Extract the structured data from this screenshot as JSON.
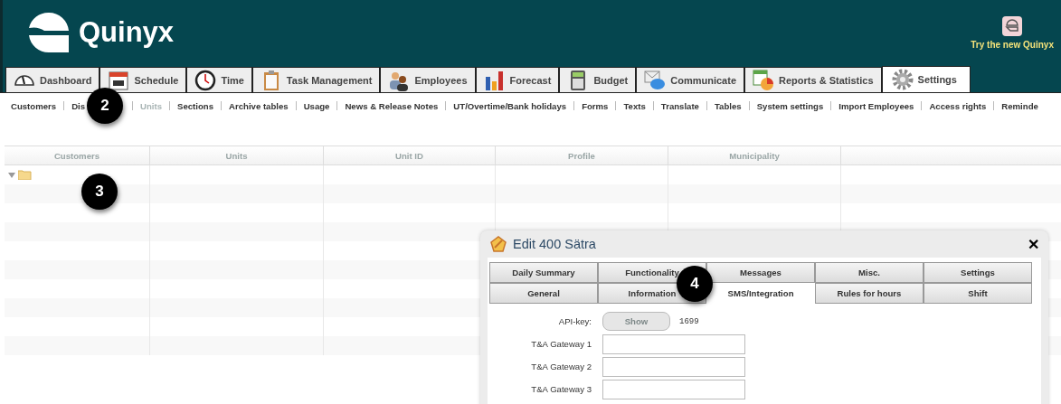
{
  "header": {
    "logo_text": "Quinyx",
    "try_new": "Try the new Quinyx"
  },
  "tabs": [
    {
      "label": "Dashboard",
      "selected": false
    },
    {
      "label": "Schedule",
      "selected": false
    },
    {
      "label": "Time",
      "selected": false
    },
    {
      "label": "Task Management",
      "selected": false
    },
    {
      "label": "Employees",
      "selected": false
    },
    {
      "label": "Forecast",
      "selected": false
    },
    {
      "label": "Budget",
      "selected": false
    },
    {
      "label": "Communicate",
      "selected": false
    },
    {
      "label": "Reports & Statistics",
      "selected": false
    },
    {
      "label": "Settings",
      "selected": true
    }
  ],
  "subnav": [
    {
      "label": "Customers",
      "selected": false
    },
    {
      "label": "Dis",
      "selected": false
    },
    {
      "label": "Units",
      "selected": true
    },
    {
      "label": "Sections",
      "selected": false
    },
    {
      "label": "Archive tables",
      "selected": false
    },
    {
      "label": "Usage",
      "selected": false
    },
    {
      "label": "News & Release Notes",
      "selected": false
    },
    {
      "label": "UT/Overtime/Bank holidays",
      "selected": false
    },
    {
      "label": "Forms",
      "selected": false
    },
    {
      "label": "Texts",
      "selected": false
    },
    {
      "label": "Translate",
      "selected": false
    },
    {
      "label": "Tables",
      "selected": false
    },
    {
      "label": "System settings",
      "selected": false
    },
    {
      "label": "Import Employees",
      "selected": false
    },
    {
      "label": "Access rights",
      "selected": false
    },
    {
      "label": "Reminde",
      "selected": false
    }
  ],
  "table": {
    "columns": [
      "Customers",
      "Units",
      "Unit ID",
      "Profile",
      "Municipality"
    ],
    "tree": {
      "expanded": true
    }
  },
  "dialog": {
    "title": "Edit 400 Sätra",
    "close": "✕",
    "tabs": [
      [
        {
          "label": "Daily Summary",
          "selected": false
        },
        {
          "label": "Functionality",
          "selected": false
        },
        {
          "label": "Messages",
          "selected": false
        },
        {
          "label": "Misc.",
          "selected": false
        },
        {
          "label": "Settings",
          "selected": false
        }
      ],
      [
        {
          "label": "General",
          "selected": false
        },
        {
          "label": "Information",
          "selected": false
        },
        {
          "label": "SMS/Integration",
          "selected": true
        },
        {
          "label": "Rules for hours",
          "selected": false
        },
        {
          "label": "Shift",
          "selected": false
        }
      ]
    ],
    "api_key": {
      "label": "API-key:",
      "button": "Show",
      "value": "1699"
    },
    "fields": [
      {
        "label": "T&A Gateway 1"
      },
      {
        "label": "T&A Gateway 2"
      },
      {
        "label": "T&A Gateway 3"
      }
    ]
  },
  "callouts": [
    "2",
    "3",
    "4"
  ]
}
